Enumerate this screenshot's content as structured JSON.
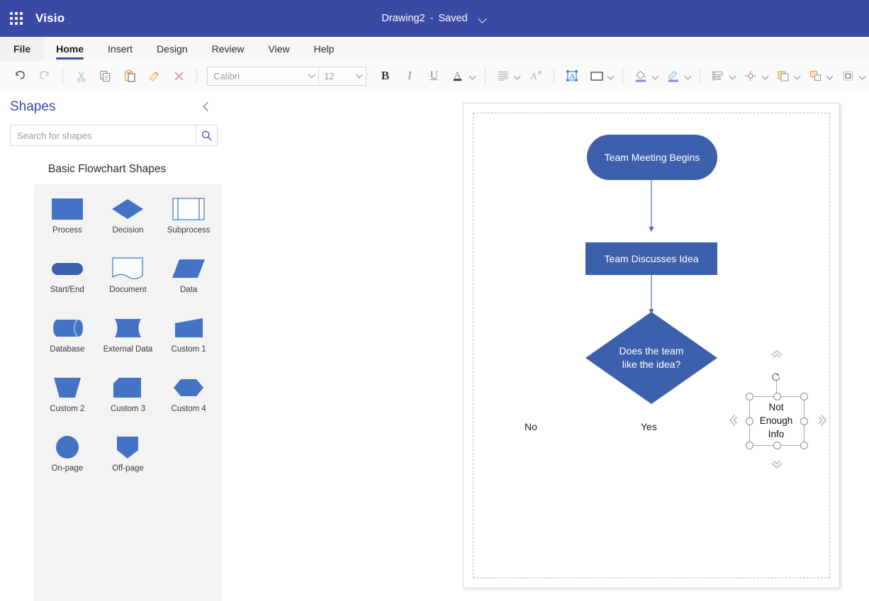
{
  "titlebar": {
    "app_name": "Visio",
    "waffle_icon": "app-launcher-icon",
    "doc_title": "Drawing2",
    "separator": "-",
    "save_state": "Saved",
    "chevron_icon": "chevron-down-icon",
    "bg_color": "#3a49a4"
  },
  "ribbon_tabs": [
    {
      "label": "File",
      "active": false,
      "is_file": true
    },
    {
      "label": "Home",
      "active": true,
      "is_file": false
    },
    {
      "label": "Insert",
      "active": false,
      "is_file": false
    },
    {
      "label": "Design",
      "active": false,
      "is_file": false
    },
    {
      "label": "Review",
      "active": false,
      "is_file": false
    },
    {
      "label": "View",
      "active": false,
      "is_file": false
    },
    {
      "label": "Help",
      "active": false,
      "is_file": false
    }
  ],
  "toolbar": {
    "undo": "Undo",
    "redo": "Redo",
    "cut": "Cut",
    "copy": "Copy",
    "paste": "Paste",
    "format_painter": "Format Painter",
    "clear": "Clear",
    "font_name": "Calibri",
    "font_size": "12",
    "bold": "B",
    "italic": "I",
    "underline": "U",
    "font_color": "A",
    "paragraph": "Paragraph",
    "text_direction": "Text Direction",
    "text_block": "Text Block",
    "line_shape": "Shape Style",
    "fill": "Fill",
    "line_color": "Line",
    "position": "Position",
    "connector": "Connector",
    "front_back": "Bring Forward",
    "group": "Group",
    "container": "Container"
  },
  "rail": {
    "stencil_icon": "flowchart-stencil-icon",
    "add_icon": "add-shapes-icon"
  },
  "shapes_panel": {
    "title": "Shapes",
    "collapse_icon": "chevron-left-icon",
    "search_placeholder": "Search for shapes",
    "search_value": "",
    "search_icon": "search-icon",
    "stencil_name": "Basic Flowchart Shapes",
    "shape_color": "#4472c4",
    "shapes": [
      {
        "label": "Process",
        "glyph": "rect"
      },
      {
        "label": "Decision",
        "glyph": "diamond"
      },
      {
        "label": "Subprocess",
        "glyph": "subprocess"
      },
      {
        "label": "Start/End",
        "glyph": "pill"
      },
      {
        "label": "Document",
        "glyph": "document"
      },
      {
        "label": "Data",
        "glyph": "parallelogram"
      },
      {
        "label": "Database",
        "glyph": "database"
      },
      {
        "label": "External Data",
        "glyph": "externaldata"
      },
      {
        "label": "Custom 1",
        "glyph": "custom1"
      },
      {
        "label": "Custom 2",
        "glyph": "trapezoid"
      },
      {
        "label": "Custom 3",
        "glyph": "custom3"
      },
      {
        "label": "Custom 4",
        "glyph": "hexagon"
      },
      {
        "label": "On-page",
        "glyph": "circle"
      },
      {
        "label": "Off-page",
        "glyph": "offpage"
      }
    ]
  },
  "canvas": {
    "shape_fill": "#3c60ab",
    "connector_color": "#4a6fbf",
    "nodes": [
      {
        "id": "start",
        "label": "Team Meeting Begins"
      },
      {
        "id": "process",
        "label": "Team Discusses Idea"
      },
      {
        "id": "decision",
        "label": "Does the team\nlike the idea?"
      }
    ],
    "decision_line1": "Does the team",
    "decision_line2": "like the idea?",
    "branch_labels": [
      {
        "id": "no",
        "label": "No"
      },
      {
        "id": "yes",
        "label": "Yes"
      }
    ],
    "selected_shape": {
      "label": "Not\nEnough\nInfo",
      "line1": "Not",
      "line2": "Enough",
      "line3": "Info",
      "rotate_icon": "rotate-handle-icon",
      "autoconnect_up": "autoconnect-up-icon",
      "autoconnect_down": "autoconnect-down-icon",
      "autoconnect_left": "autoconnect-left-icon",
      "autoconnect_right": "autoconnect-right-icon"
    }
  }
}
